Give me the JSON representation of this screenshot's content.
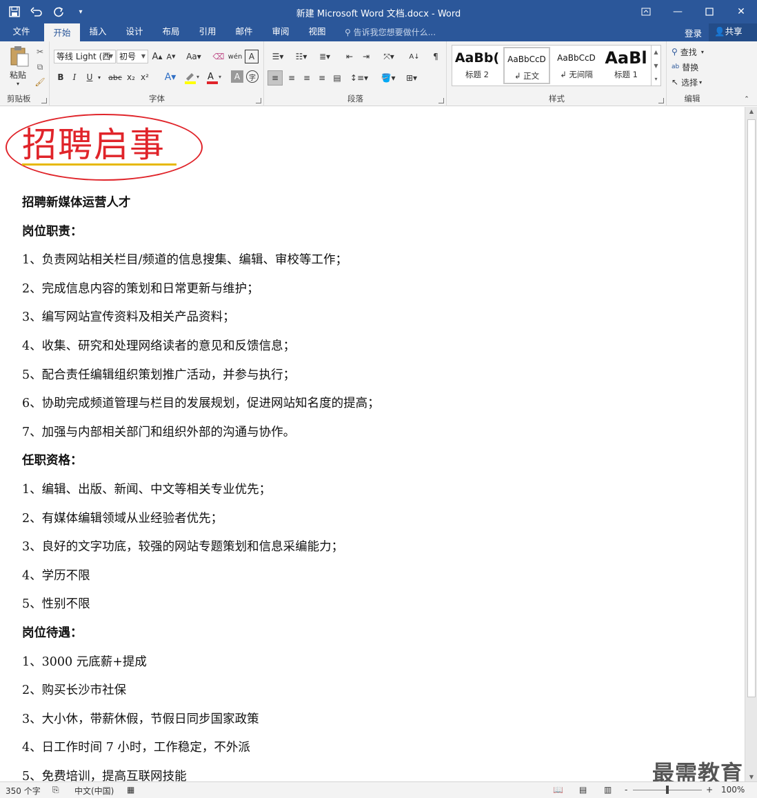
{
  "window": {
    "title": "新建 Microsoft Word 文档.docx - Word",
    "qat_icons": [
      "save-icon",
      "undo-icon",
      "redo-icon",
      "customize-icon"
    ],
    "controls": [
      "ribbon-display-icon",
      "minimize-icon",
      "maximize-icon",
      "close-icon"
    ]
  },
  "tabs": [
    "文件",
    "开始",
    "插入",
    "设计",
    "布局",
    "引用",
    "邮件",
    "审阅",
    "视图"
  ],
  "active_tab": "开始",
  "tell_me": "告诉我您想要做什么...",
  "login": "登录",
  "share": "共享",
  "ribbon": {
    "clipboard": {
      "paste": "粘贴",
      "label": "剪贴板"
    },
    "font": {
      "font_name": "等线 Light (西",
      "font_size": "初号",
      "label": "字体",
      "buttons": [
        "B",
        "I",
        "U",
        "abc",
        "x₂",
        "x²",
        "A",
        "A"
      ]
    },
    "paragraph": {
      "label": "段落"
    },
    "styles": {
      "items": [
        {
          "preview": "AaBb(",
          "name": "标题 2"
        },
        {
          "preview": "AaBbCcD",
          "name": "↲ 正文"
        },
        {
          "preview": "AaBbCcD",
          "name": "↲ 无间隔"
        },
        {
          "preview": "AaBl",
          "name": "标题 1"
        }
      ],
      "label": "样式"
    },
    "editing": {
      "find": "查找",
      "replace": "替换",
      "select": "选择",
      "label": "编辑"
    }
  },
  "document": {
    "title": "招聘启事",
    "lines": [
      {
        "text": "招聘新媒体运营人才",
        "bold": true
      },
      {
        "text": "岗位职责：",
        "bold": true
      },
      {
        "text": "1、负责网站相关栏目/频道的信息搜集、编辑、审校等工作；",
        "bold": false
      },
      {
        "text": "2、完成信息内容的策划和日常更新与维护；",
        "bold": false
      },
      {
        "text": "3、编写网站宣传资料及相关产品资料；",
        "bold": false
      },
      {
        "text": "4、收集、研究和处理网络读者的意见和反馈信息；",
        "bold": false
      },
      {
        "text": "5、配合责任编辑组织策划推广活动，并参与执行；",
        "bold": false
      },
      {
        "text": "6、协助完成频道管理与栏目的发展规划，促进网站知名度的提高；",
        "bold": false
      },
      {
        "text": "7、加强与内部相关部门和组织外部的沟通与协作。",
        "bold": false
      },
      {
        "text": "任职资格：",
        "bold": true
      },
      {
        "text": "1、编辑、出版、新闻、中文等相关专业优先；",
        "bold": false
      },
      {
        "text": "2、有媒体编辑领域从业经验者优先；",
        "bold": false
      },
      {
        "text": "3、良好的文字功底，较强的网站专题策划和信息采编能力；",
        "bold": false
      },
      {
        "text": "4、学历不限",
        "bold": false
      },
      {
        "text": "5、性别不限",
        "bold": false
      },
      {
        "text": "岗位待遇：",
        "bold": true
      },
      {
        "text": "1、3000 元底薪+提成",
        "bold": false
      },
      {
        "text": "2、购买长沙市社保",
        "bold": false
      },
      {
        "text": "3、大小休，带薪休假，节假日同步国家政策",
        "bold": false
      },
      {
        "text": "4、日工作时间 7 小时，工作稳定，不外派",
        "bold": false
      },
      {
        "text": "5、免费培训，提高互联网技能",
        "bold": false
      }
    ]
  },
  "watermark": "最需教育",
  "status": {
    "word_count": "350 个字",
    "language": "中文(中国)",
    "zoom": "100%",
    "zoom_minus": "-",
    "zoom_plus": "+"
  }
}
